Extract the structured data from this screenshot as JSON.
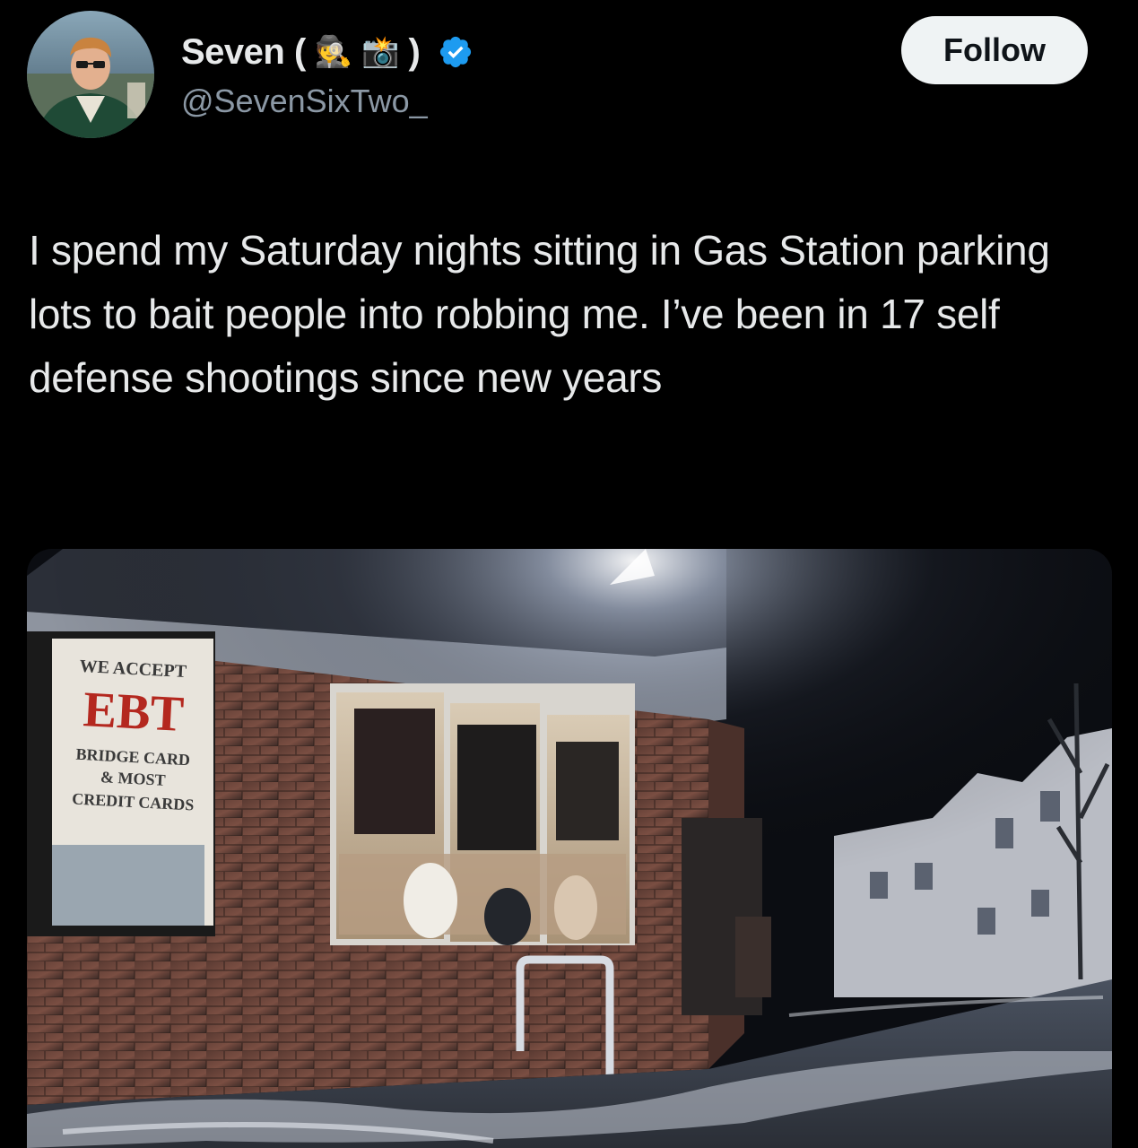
{
  "post": {
    "author": {
      "display_name": "Seven (",
      "emoji_1": "🕵",
      "emoji_2": "📸",
      "display_name_end": ")",
      "handle": "@SevenSixTwo_",
      "verified": true
    },
    "follow_label": "Follow",
    "text": "I spend my Saturday nights sitting in Gas Station parking lots to bait people into robbing me. I’ve been in 17 self defense shootings since new years",
    "media": {
      "sign_line_1": "WE ACCEPT",
      "sign_line_2": "EBT",
      "sign_line_3": "BRIDGE CARD",
      "sign_line_4": "& MOST",
      "sign_line_5": "CREDIT CARDS"
    }
  },
  "colors": {
    "background": "#000000",
    "text": "#e7e9ea",
    "secondary_text": "#8b98a5",
    "verified": "#1d9bf0",
    "follow_bg": "#eff3f4",
    "follow_text": "#0f1419"
  }
}
